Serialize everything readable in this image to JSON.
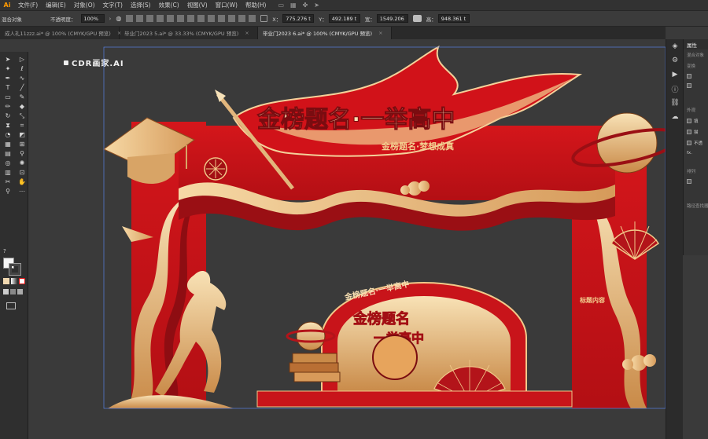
{
  "app": {
    "logo": "Ai"
  },
  "menu": [
    "文件(F)",
    "编辑(E)",
    "对象(O)",
    "文字(T)",
    "选择(S)",
    "效果(C)",
    "视图(V)",
    "窗口(W)",
    "帮助(H)"
  ],
  "control": {
    "mode_label": "混合对象",
    "opacity_label": "不透明度：",
    "opacity_value": "100%",
    "x_label": "X：",
    "x_value": "775.276 t",
    "y_label": "Y：",
    "y_value": "492.189 t",
    "w_label": "宽：",
    "w_value": "1549.206",
    "h_label": "高：",
    "h_value": "948.361 t"
  },
  "tabs": [
    {
      "label": "成人礼11zzz.ai* @ 100% (CMYK/GPU 预览)",
      "active": false
    },
    {
      "label": "毕业门2023 5.ai* @ 33.33% (CMYK/GPU 预览)",
      "active": false
    },
    {
      "label": "毕业门2023 6.ai* @ 100% (CMYK/GPU 预览)",
      "active": true
    }
  ],
  "artboard": {
    "label": "CDR画家.AI"
  },
  "design": {
    "main_title": "金榜题名·一举高中",
    "sub_title": "金榜题名·梦想成真",
    "center_title": "金榜题名",
    "center_title2": "一举高中",
    "center_arc": "金榜题名·一举高中",
    "side_text": "标题内容",
    "colors": {
      "red": "#c8141a",
      "dark_red": "#8e0d12",
      "gold": "#e6b877",
      "light_gold": "#f6dcae"
    }
  },
  "properties": {
    "tab": "属性",
    "mix": "混合对象",
    "transform": "变换",
    "appearance": "外观",
    "fill": "填",
    "stroke": "描",
    "opacity": "不透",
    "fx": "fx.",
    "arrange": "排列",
    "note": "路径查找器"
  }
}
